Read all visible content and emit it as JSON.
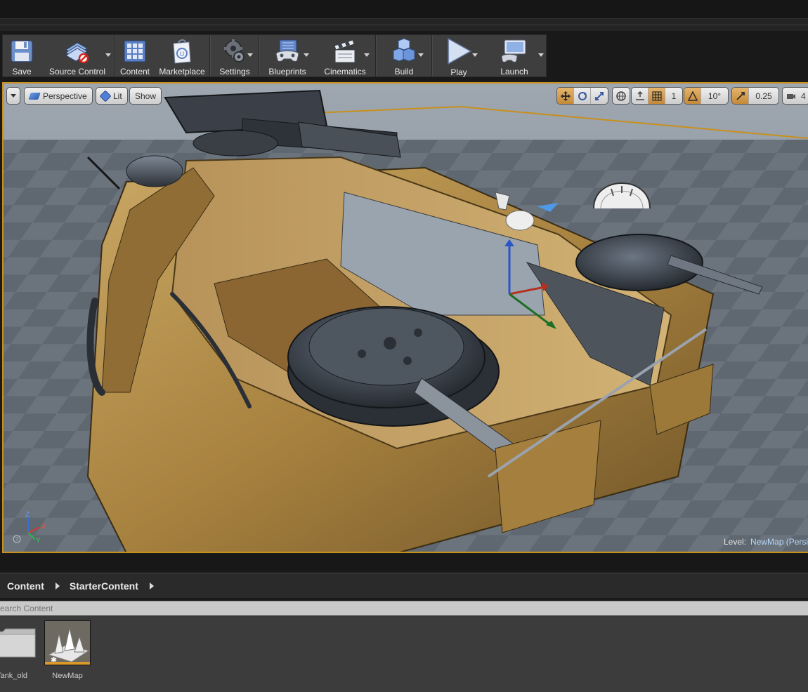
{
  "toolbar": {
    "buttons": [
      {
        "id": "save",
        "label": "Save",
        "icon": "floppy-disk-icon"
      },
      {
        "id": "source_control",
        "label": "Source Control",
        "icon": "source-control-icon"
      },
      {
        "id": "content",
        "label": "Content",
        "icon": "content-grid-icon"
      },
      {
        "id": "marketplace",
        "label": "Marketplace",
        "icon": "marketplace-bag-icon"
      },
      {
        "id": "settings",
        "label": "Settings",
        "icon": "gear-icon"
      },
      {
        "id": "blueprints",
        "label": "Blueprints",
        "icon": "blueprint-gamepad-icon"
      },
      {
        "id": "cinematics",
        "label": "Cinematics",
        "icon": "clapperboard-icon"
      },
      {
        "id": "build",
        "label": "Build",
        "icon": "build-cubes-icon"
      },
      {
        "id": "play",
        "label": "Play",
        "icon": "play-triangle-icon"
      },
      {
        "id": "launch",
        "label": "Launch",
        "icon": "launch-monitor-icon"
      }
    ]
  },
  "viewport": {
    "perspective_label": "Perspective",
    "lit_label": "Lit",
    "show_label": "Show",
    "grid_snap_value": "1",
    "rotation_snap_value": "10°",
    "scale_snap_value": "0.25",
    "camera_speed_value": "4",
    "level_label": "Level:",
    "level_value": "NewMap (Persistent)",
    "axis_labels": {
      "z": "Z",
      "x": "X",
      "y": "Y"
    },
    "colors": {
      "selection_border": "#c8901c",
      "snap_active": "#d39a46",
      "level_value": "#b6d7f5"
    }
  },
  "content_browser": {
    "breadcrumb": [
      "Content",
      "StarterContent"
    ],
    "search_placeholder": "Search Content",
    "assets": [
      {
        "name": "Tank_old",
        "type": "folder",
        "icon": "folder-icon"
      },
      {
        "name": "NewMap",
        "type": "level",
        "icon": "level-map-icon"
      }
    ]
  }
}
